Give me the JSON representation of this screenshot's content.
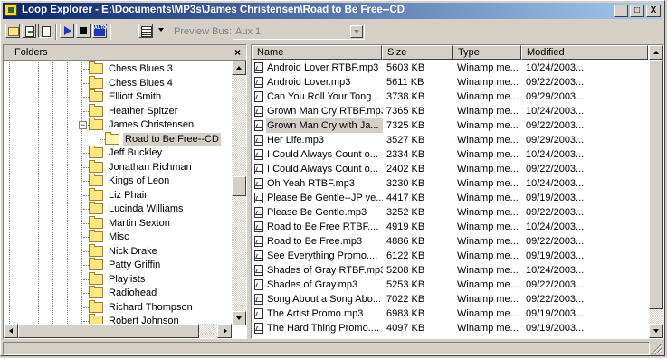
{
  "window": {
    "title": "Loop Explorer - E:\\Documents\\MP3s\\James Christensen\\Road to Be Free--CD",
    "minimize": "_",
    "maximize": "□",
    "close": "X"
  },
  "toolbar": {
    "preview_bus_label": "Preview Bus:",
    "preview_bus_value": "Aux 1",
    "auto_label": "AUTO"
  },
  "folders": {
    "header": "Folders",
    "close": "×",
    "items": [
      {
        "label": "Chess Blues 3"
      },
      {
        "label": "Chess Blues 4"
      },
      {
        "label": "Elliott Smith"
      },
      {
        "label": "Heather Spitzer"
      },
      {
        "label": "James Christensen",
        "expanded": true
      },
      {
        "label": "Road to Be Free--CD",
        "selected": true
      },
      {
        "label": "Jeff Buckley"
      },
      {
        "label": "Jonathan Richman"
      },
      {
        "label": "Kings of Leon"
      },
      {
        "label": "Liz Phair"
      },
      {
        "label": "Lucinda Williams"
      },
      {
        "label": "Martin Sexton"
      },
      {
        "label": "Misc"
      },
      {
        "label": "Nick Drake"
      },
      {
        "label": "Patty Griffin"
      },
      {
        "label": "Playlists"
      },
      {
        "label": "Radiohead"
      },
      {
        "label": "Richard Thompson"
      },
      {
        "label": "Robert Johnson"
      }
    ],
    "expander_minus": "−"
  },
  "files": {
    "columns": [
      "Name",
      "Size",
      "Type",
      "Modified"
    ],
    "rows": [
      {
        "name": "Android Lover RTBF.mp3",
        "size": "5603 KB",
        "type": "Winamp me...",
        "modified": "10/24/2003..."
      },
      {
        "name": "Android Lover.mp3",
        "size": "5611 KB",
        "type": "Winamp me...",
        "modified": "09/22/2003..."
      },
      {
        "name": "Can You Roll Your Tong...",
        "size": "3738 KB",
        "type": "Winamp me...",
        "modified": "09/29/2003..."
      },
      {
        "name": "Grown Man Cry RTBF.mp3",
        "size": "7365 KB",
        "type": "Winamp me...",
        "modified": "10/24/2003..."
      },
      {
        "name": "Grown Man Cry with Ja...",
        "size": "7325 KB",
        "type": "Winamp me...",
        "modified": "09/22/2003...",
        "selected": true
      },
      {
        "name": "Her Life.mp3",
        "size": "3527 KB",
        "type": "Winamp me...",
        "modified": "09/29/2003..."
      },
      {
        "name": "I Could Always Count o...",
        "size": "2334 KB",
        "type": "Winamp me...",
        "modified": "10/24/2003..."
      },
      {
        "name": "I Could Always Count o...",
        "size": "2402 KB",
        "type": "Winamp me...",
        "modified": "09/22/2003..."
      },
      {
        "name": "Oh Yeah RTBF.mp3",
        "size": "3230 KB",
        "type": "Winamp me...",
        "modified": "10/24/2003..."
      },
      {
        "name": "Please Be Gentle--JP ve...",
        "size": "4417 KB",
        "type": "Winamp me...",
        "modified": "09/19/2003..."
      },
      {
        "name": "Please Be Gentle.mp3",
        "size": "3252 KB",
        "type": "Winamp me...",
        "modified": "09/22/2003..."
      },
      {
        "name": "Road to Be Free RTBF....",
        "size": "4919 KB",
        "type": "Winamp me...",
        "modified": "10/24/2003..."
      },
      {
        "name": "Road to Be Free.mp3",
        "size": "4886 KB",
        "type": "Winamp me...",
        "modified": "09/22/2003..."
      },
      {
        "name": "See Everything Promo....",
        "size": "6122 KB",
        "type": "Winamp me...",
        "modified": "09/19/2003..."
      },
      {
        "name": "Shades of Gray RTBF.mp3",
        "size": "5208 KB",
        "type": "Winamp me...",
        "modified": "10/24/2003..."
      },
      {
        "name": "Shades of Gray.mp3",
        "size": "5253 KB",
        "type": "Winamp me...",
        "modified": "09/22/2003..."
      },
      {
        "name": "Song About a Song Abo...",
        "size": "7022 KB",
        "type": "Winamp me...",
        "modified": "09/22/2003..."
      },
      {
        "name": "The Artist Promo.mp3",
        "size": "6983 KB",
        "type": "Winamp me...",
        "modified": "09/19/2003..."
      },
      {
        "name": "The Hard Thing Promo....",
        "size": "4097 KB",
        "type": "Winamp me...",
        "modified": "09/19/2003..."
      }
    ]
  },
  "colors": {
    "title_gradient_start": "#0a246a",
    "title_gradient_end": "#a6caf0",
    "face": "#d4d0c8"
  }
}
